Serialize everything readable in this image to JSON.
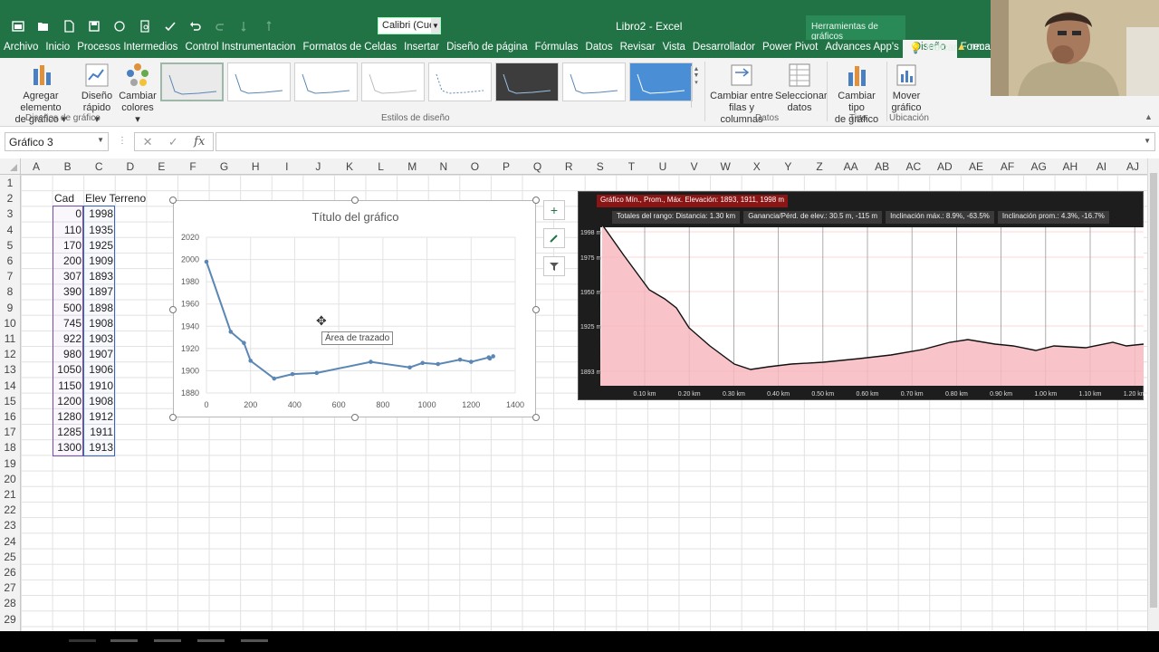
{
  "window": {
    "title": "Libro2 - Excel",
    "context_tools": "Herramientas de gráficos",
    "font_box": "Calibri (Cuerp"
  },
  "tabs": [
    {
      "label": "Archivo"
    },
    {
      "label": "Inicio"
    },
    {
      "label": "Procesos Intermedios"
    },
    {
      "label": "Control Instrumentacion"
    },
    {
      "label": "Formatos de Celdas"
    },
    {
      "label": "Insertar"
    },
    {
      "label": "Diseño de página"
    },
    {
      "label": "Fórmulas"
    },
    {
      "label": "Datos"
    },
    {
      "label": "Revisar"
    },
    {
      "label": "Vista"
    },
    {
      "label": "Desarrollador"
    },
    {
      "label": "Power Pivot"
    },
    {
      "label": "Advances App's"
    },
    {
      "label": "Diseño"
    },
    {
      "label": "Formato"
    }
  ],
  "tell_me": "Indicar",
  "share": "reca",
  "ribbon": {
    "add_element_1": "Agregar elemento",
    "add_element_2": "de gráfico ▾",
    "quick_layout_1": "Diseño",
    "quick_layout_2": "rápido ▾",
    "change_colors_1": "Cambiar",
    "change_colors_2": "colores ▾",
    "group_layouts": "Diseños de gráfico",
    "group_styles": "Estilos de diseño",
    "switch_rowcol_1": "Cambiar entre",
    "switch_rowcol_2": "filas y columnas",
    "select_data_1": "Seleccionar",
    "select_data_2": "datos",
    "group_data": "Datos",
    "change_type_1": "Cambiar tipo",
    "change_type_2": "de gráfico",
    "group_type": "Tipo",
    "move_chart_1": "Mover",
    "move_chart_2": "gráfico",
    "group_location": "Ubicación"
  },
  "formula_bar": {
    "name_box": "Gráfico 3",
    "fx": "fx"
  },
  "columns": [
    "A",
    "B",
    "C",
    "D",
    "E",
    "F",
    "G",
    "H",
    "I",
    "J",
    "K",
    "L",
    "M",
    "N",
    "O",
    "P",
    "Q",
    "R",
    "S",
    "T",
    "U",
    "V",
    "W",
    "X",
    "Y",
    "Z",
    "AA",
    "AB",
    "AC",
    "AD",
    "AE",
    "AF",
    "AG",
    "AH",
    "AI",
    "AJ"
  ],
  "rows": [
    "1",
    "2",
    "3",
    "4",
    "5",
    "6",
    "7",
    "8",
    "9",
    "10",
    "11",
    "12",
    "13",
    "14",
    "15",
    "16",
    "17",
    "18",
    "19",
    "20",
    "21",
    "22",
    "23",
    "24",
    "25",
    "26",
    "27",
    "28",
    "29"
  ],
  "table": {
    "header_b": "Cad",
    "header_c": "Elev Terreno",
    "cad": [
      "0",
      "110",
      "170",
      "200",
      "307",
      "390",
      "500",
      "745",
      "922",
      "980",
      "1050",
      "1150",
      "1200",
      "1280",
      "1285",
      "1300"
    ],
    "elev": [
      "1998",
      "1935",
      "1925",
      "1909",
      "1893",
      "1897",
      "1898",
      "1908",
      "1903",
      "1907",
      "1906",
      "1910",
      "1908",
      "1912",
      "1911",
      "1913"
    ]
  },
  "chart_data": {
    "type": "scatter",
    "title": "Título del gráfico",
    "x": [
      0,
      110,
      170,
      200,
      307,
      390,
      500,
      745,
      922,
      980,
      1050,
      1150,
      1200,
      1280,
      1285,
      1300
    ],
    "y": [
      1998,
      1935,
      1925,
      1909,
      1893,
      1897,
      1898,
      1908,
      1903,
      1907,
      1906,
      1910,
      1908,
      1912,
      1911,
      1913
    ],
    "xlim": [
      0,
      1400
    ],
    "ylim": [
      1880,
      2020
    ],
    "xticks": [
      "0",
      "200",
      "400",
      "600",
      "800",
      "1000",
      "1200",
      "1400"
    ],
    "yticks": [
      "2020",
      "2000",
      "1980",
      "1960",
      "1940",
      "1920",
      "1900",
      "1880"
    ],
    "grid": true,
    "line_color": "#5b87b5",
    "tooltip": "Área de trazado"
  },
  "profile": {
    "header": "Gráfico Mín., Prom., Máx. Elevación: 1893, 1911, 1998 m",
    "stats": [
      "Totales del rango: Distancia: 1.30 km",
      "Ganancia/Pérd. de elev.: 30.5 m, -115 m",
      "Inclinación máx.: 8.9%, -63.5%",
      "Inclinación prom.: 4.3%, -16.7%"
    ],
    "y_labels": [
      "1998 m",
      "1975 m",
      "1950 m",
      "1925 m",
      "1893 m"
    ],
    "x_labels": [
      "0.10 km",
      "0.20 km",
      "0.30 km",
      "0.40 km",
      "0.50 km",
      "0.60 km",
      "0.70 km",
      "0.80 km",
      "0.90 km",
      "1.00 km",
      "1.10 km",
      "1.20 km"
    ],
    "fill_color": "#f7b8bf"
  },
  "colors": {
    "excel_green": "#217346",
    "ribbon_bg": "#f3f3f3"
  }
}
